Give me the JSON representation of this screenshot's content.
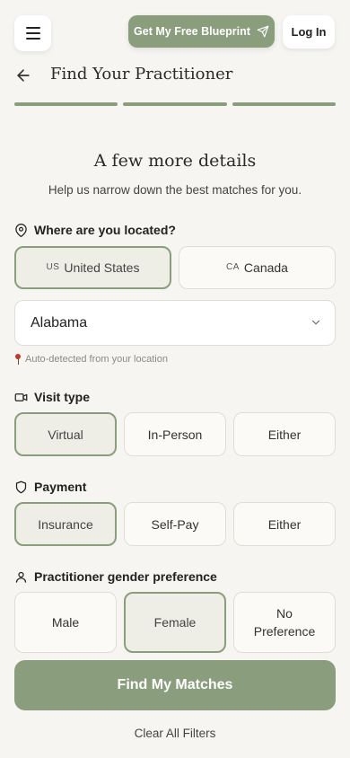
{
  "header": {
    "menu_icon": "hamburger-icon",
    "blueprint_label": "Get My Free Blueprint",
    "blueprint_icon": "send-icon",
    "login_label": "Log In"
  },
  "titlebar": {
    "back_icon": "arrow-left-icon",
    "title": "Find Your Practitioner"
  },
  "progress": {
    "steps_total": 3,
    "steps_completed": 3
  },
  "intro": {
    "heading": "A few more details",
    "subheading": "Help us narrow down the best matches for you."
  },
  "location": {
    "label": "Where are you located?",
    "icon": "map-pin-icon",
    "countries": [
      {
        "code": "US",
        "name": "United States",
        "selected": true
      },
      {
        "code": "CA",
        "name": "Canada",
        "selected": false
      }
    ],
    "state_value": "Alabama",
    "hint": "Auto-detected from your location"
  },
  "visit_type": {
    "label": "Visit type",
    "icon": "video-icon",
    "options": [
      "Virtual",
      "In-Person",
      "Either"
    ],
    "selected": "Virtual"
  },
  "payment": {
    "label": "Payment",
    "icon": "shield-icon",
    "options": [
      "Insurance",
      "Self-Pay",
      "Either"
    ],
    "selected": "Insurance"
  },
  "gender": {
    "label": "Practitioner gender preference",
    "icon": "user-icon",
    "options": [
      "Male",
      "Female",
      "No Preference"
    ],
    "selected": "Female"
  },
  "actions": {
    "find_label": "Find My Matches",
    "clear_label": "Clear All Filters"
  },
  "colors": {
    "accent": "#8a9d7d",
    "background": "#f6f5f1",
    "selected_bg": "#eeeee6"
  }
}
